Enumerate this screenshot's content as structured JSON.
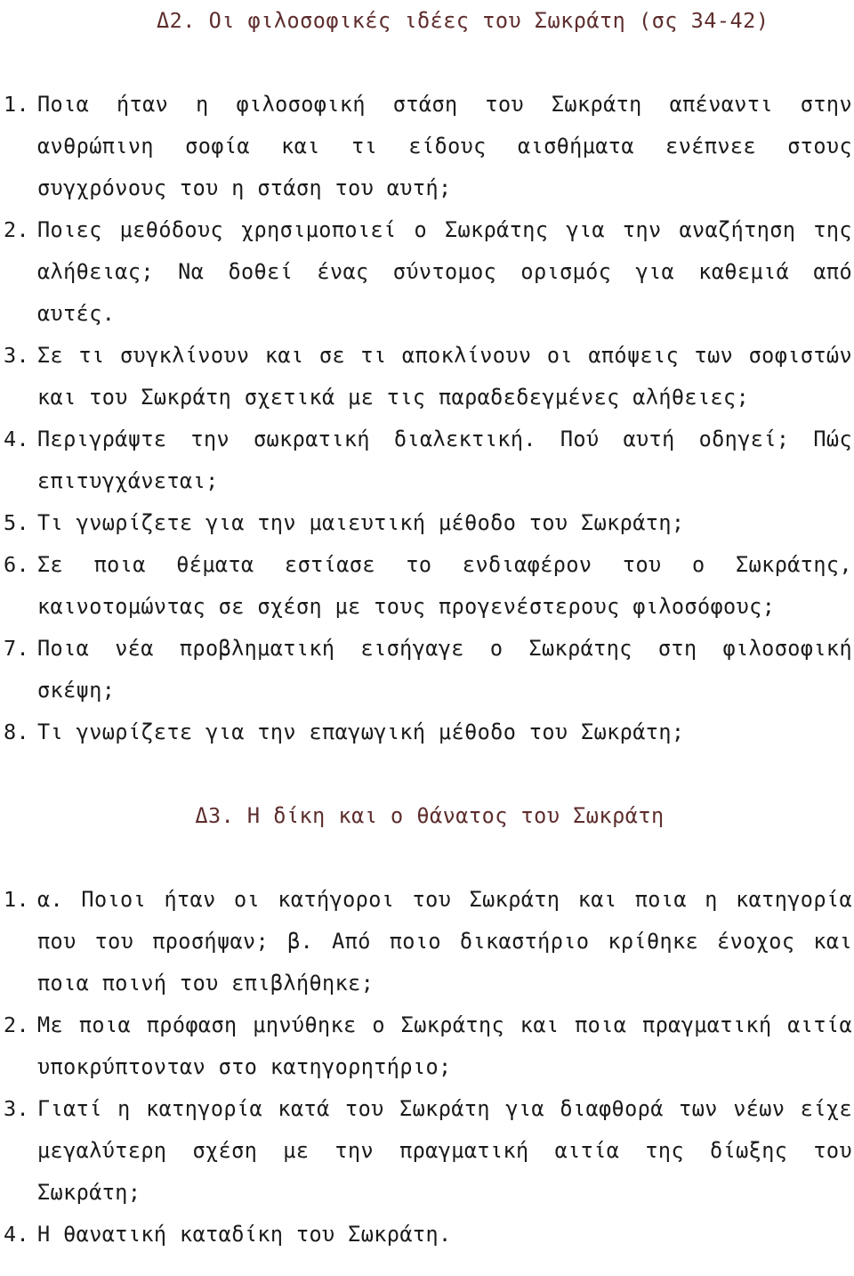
{
  "document": {
    "language": "el",
    "background_color": "#ffffff",
    "text_color": "#1a1a1a",
    "heading_color": "#5e2d2d"
  },
  "sections": [
    {
      "id": "delta2",
      "heading": "Δ2. Οι φιλοσοφικές ιδέες του Σωκράτη (σς 34-42)",
      "questions": [
        {
          "number": "1.",
          "text": "Ποια ήταν η φιλοσοφική στάση του Σωκράτη απέναντι στην ανθρώπινη σοφία και τι είδους αισθήματα ενέπνεε στους συγχρόνους του η στάση του αυτή;"
        },
        {
          "number": "2.",
          "text": "Ποιες μεθόδους χρησιμοποιεί ο Σωκράτης για την αναζήτηση της αλήθειας; Να δοθεί ένας σύντομος ορισμός για καθεμιά από αυτές."
        },
        {
          "number": "3.",
          "text": "Σε τι συγκλίνουν και σε τι αποκλίνουν οι απόψεις των σοφιστών και του Σωκράτη σχετικά με τις παραδεδεγμένες αλήθειες;"
        },
        {
          "number": "4.",
          "text": "Περιγράψτε την σωκρατική διαλεκτική. Πού αυτή οδηγεί; Πώς επιτυγχάνεται;"
        },
        {
          "number": "5.",
          "text": "Τι γνωρίζετε για την μαιευτική μέθοδο του Σωκράτη;"
        },
        {
          "number": "6.",
          "text": "Σε ποια θέματα εστίασε το ενδιαφέρον του ο Σωκράτης, καινοτομώντας σε σχέση με τους προγενέστερους φιλοσόφους;"
        },
        {
          "number": "7.",
          "text": "Ποια νέα προβληματική εισήγαγε ο Σωκράτης στη φιλοσοφική σκέψη;"
        },
        {
          "number": "8.",
          "text": "Τι γνωρίζετε για την επαγωγική μέθοδο του Σωκράτη;"
        }
      ]
    },
    {
      "id": "delta3",
      "heading": "Δ3. Η δίκη και ο θάνατος του Σωκράτη",
      "questions": [
        {
          "number": "1.",
          "text": "α. Ποιοι ήταν οι κατήγοροι του Σωκράτη και ποια η κατηγορία που του προσήψαν; β. Από ποιο δικαστήριο κρίθηκε ένοχος και ποια ποινή του επιβλήθηκε;"
        },
        {
          "number": "2.",
          "text": "Με ποια πρόφαση μηνύθηκε ο Σωκράτης και ποια πραγματική αιτία υποκρύπτονταν στο κατηγορητήριο;"
        },
        {
          "number": "3.",
          "text": "Γιατί η κατηγορία κατά του Σωκράτη για διαφθορά των νέων είχε μεγαλύτερη σχέση με την πραγματική αιτία της δίωξης του Σωκράτη;"
        },
        {
          "number": "4.",
          "text": "Η θανατική καταδίκη του Σωκράτη."
        }
      ]
    }
  ]
}
